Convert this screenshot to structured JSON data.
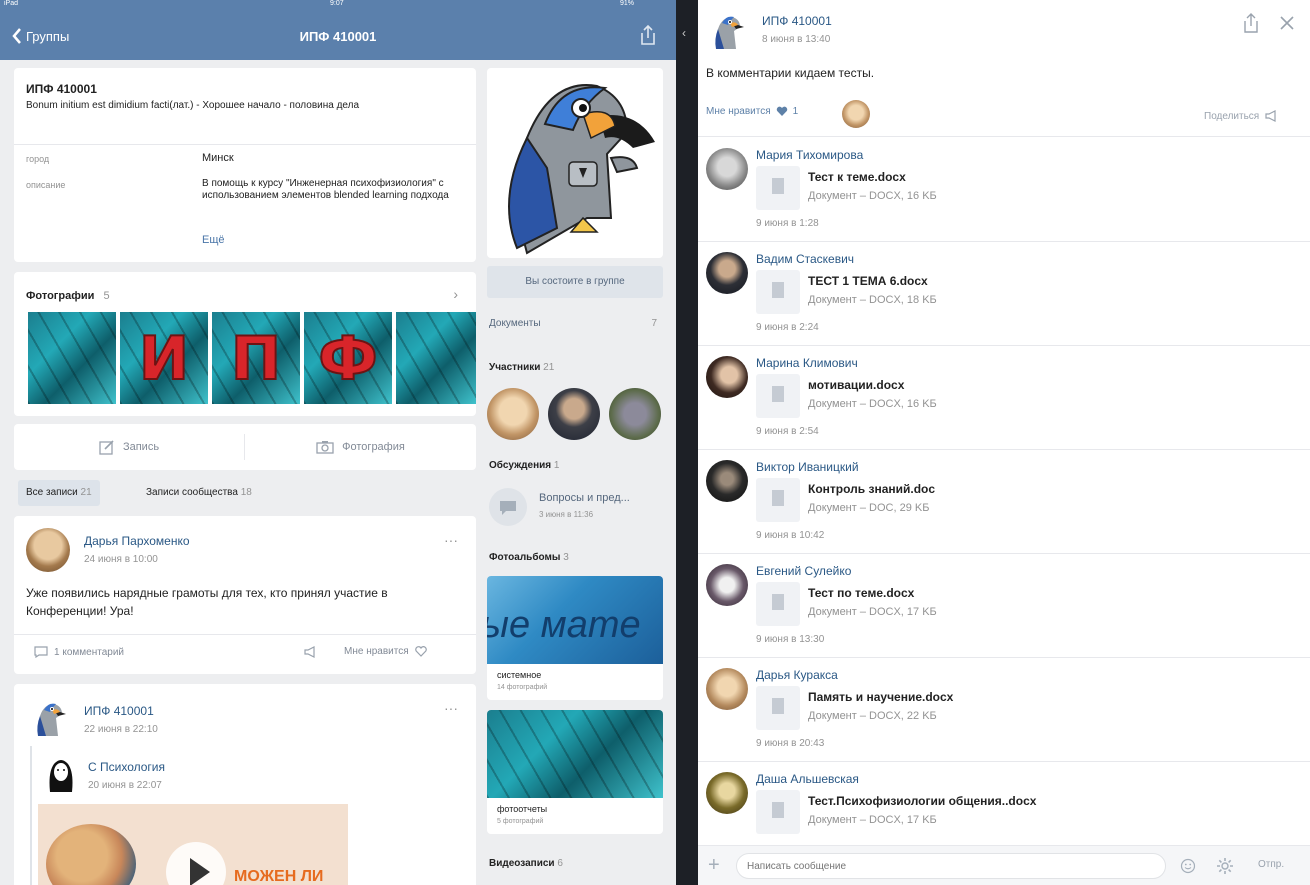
{
  "status_bar": {
    "left": "iPad",
    "center": "9:07",
    "right": "91%"
  },
  "nav": {
    "back_label": "Группы",
    "title": "ИПФ 410001"
  },
  "group_info": {
    "name": "ИПФ 410001",
    "status": "Bonum initium est dimidium facti(лат.) - Хорошее начало - половина дела",
    "city_label": "город",
    "city_value": "Минск",
    "description_label": "описание",
    "description_value": "В помощь к курсу \"Инженерная психофизиология\" с использованием элементов blended learning подхода",
    "more_label": "Ещё"
  },
  "photos": {
    "title": "Фотографии",
    "count": "5",
    "letters": [
      "И",
      "П",
      "Ф"
    ]
  },
  "actions": {
    "post_label": "Запись",
    "photo_label": "Фотография"
  },
  "wall_tabs": {
    "all_label": "Все записи",
    "all_count": "21",
    "community_label": "Записи сообщества",
    "community_count": "18"
  },
  "post1": {
    "author": "Дарья Пархоменко",
    "time": "24 июня в 10:00",
    "text": "Уже появились нарядные грамоты для тех, кто принял участие в Конференции! Ура!",
    "comments_label": "1 комментарий",
    "like_label": "Мне нравится"
  },
  "post2": {
    "author": "ИПФ 410001",
    "time": "22 июня в 22:10",
    "repost_author": "Психология",
    "repost_time": "20 июня в 22:07",
    "video_text": "МОЖЕН ЛИ"
  },
  "sidebar": {
    "member_button": "Вы состоите в группе",
    "documents_label": "Документы",
    "documents_count": "7",
    "members_label": "Участники",
    "members_count": "21",
    "discussions_label": "Обсуждения",
    "discussions_count": "1",
    "discussion_title": "Вопросы и пред...",
    "discussion_time": "3 июня в 11:36",
    "albums_label": "Фотоальбомы",
    "albums_count": "3",
    "album1_banner": "ые мате",
    "album1_title": "системное",
    "album1_sub": "14 фотографий",
    "album2_title": "фотоотчеты",
    "album2_sub": "5 фотографий",
    "videos_label": "Видеозаписи",
    "videos_count": "6"
  },
  "right_panel": {
    "author": "ИПФ 410001",
    "time": "8 июня в 13:40",
    "text": "В комментарии кидаем тесты.",
    "like_label": "Мне нравится",
    "like_count": "1",
    "share_label": "Поделиться",
    "comments": [
      {
        "name": "Мария Тихомирова",
        "doc": "Тест к теме.docx",
        "meta": "Документ – DOCX, 16 KБ",
        "time": "9 июня в 1:28"
      },
      {
        "name": "Вадим Стаскевич",
        "doc": "ТЕСТ 1 ТЕМА 6.docx",
        "meta": "Документ – DOCX, 18 KБ",
        "time": "9 июня в 2:24"
      },
      {
        "name": "Марина Климович",
        "doc": "мотивации.docx",
        "meta": "Документ – DOCX, 16 KБ",
        "time": "9 июня в 2:54"
      },
      {
        "name": "Виктор Иваницкий",
        "doc": "Контроль знаний.doc",
        "meta": "Документ – DOC, 29 KБ",
        "time": "9 июня в 10:42"
      },
      {
        "name": "Евгений Сулейко",
        "doc": "Тест по теме.docx",
        "meta": "Документ – DOCX, 17 KБ",
        "time": "9 июня в 13:30"
      },
      {
        "name": "Дарья Куракса",
        "doc": "Память и научение.docx",
        "meta": "Документ – DOCX, 22 KБ",
        "time": "9 июня в 20:43"
      },
      {
        "name": "Даша Альшевская",
        "doc": "Тест.Психофизиологии общения..docx",
        "meta": "Документ – DOCX, 17 KБ",
        "time": ""
      }
    ],
    "input_placeholder": "Написать сообщение",
    "send_label": "Отпр."
  },
  "colors": {
    "header": "#5b80ac",
    "link": "#2a5885",
    "background": "#edeef0"
  }
}
